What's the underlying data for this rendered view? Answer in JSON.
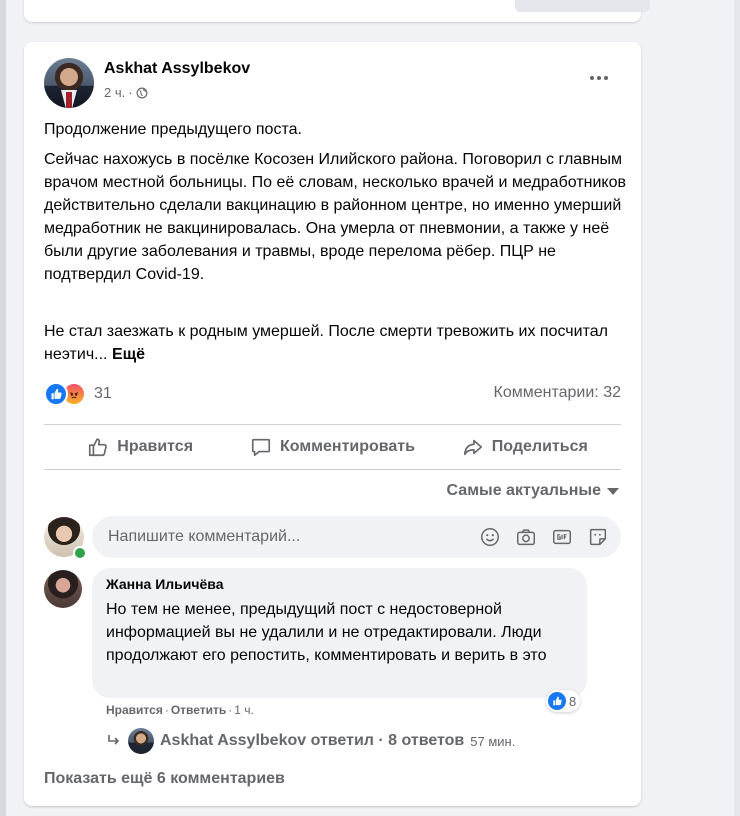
{
  "post": {
    "author": "Askhat Assylbekov",
    "time": "2 ч.",
    "separator": "·",
    "paragraph1": "Продолжение предыдущего поста.",
    "paragraph2": "Сейчас нахожусь в посёлке Косозен Илийского района. Поговорил с главным врачом местной больницы. По её словам, несколько врачей и медработников действительно сделали вакцинацию в районном центре, но именно умерший медработник не вакцинировалась. Она умерла от пневмонии, а также у неё были другие заболевания и травмы, вроде перелома рёбер. ПЦР не подтвердил Covid-19.",
    "paragraph3": "Не стал заезжать к родным умершей. После смерти тревожить их посчитал неэтич...",
    "see_more": "Ещё",
    "reaction_count": "31",
    "comments_count": "Комментарии: 32"
  },
  "actions": {
    "like": "Нравится",
    "comment": "Комментировать",
    "share": "Поделиться"
  },
  "sort": {
    "label": "Самые актуальные"
  },
  "comment_input": {
    "placeholder": "Напишите комментарий..."
  },
  "comments": [
    {
      "author": "Жанна Ильичёва",
      "text": "Но тем не менее, предыдущий пост с недостоверной информацией вы не удалили и не отредактировали. Люди продолжают его репостить, комментировать и верить в это",
      "like_count": "8",
      "like_label": "Нравится",
      "reply_label": "Ответить",
      "time": "1 ч.",
      "reply_summary": "Askhat Assylbekov ответил · 8 ответов",
      "reply_time": "57 мин."
    }
  ],
  "show_more": "Показать ещё 6 комментариев",
  "colors": {
    "accent": "#1877f2",
    "text": "#050505",
    "secondary_text": "#65676b",
    "background": "#f0f2f5",
    "online": "#31a24c"
  },
  "icons": {
    "post_privacy": "globe-icon",
    "more": "more-horizontal-icon",
    "like": "thumbs-up-icon",
    "comment": "comment-bubble-icon",
    "share": "share-arrow-icon",
    "emoji": "emoji-icon",
    "camera": "camera-icon",
    "gif": "gif-icon",
    "sticker": "sticker-icon",
    "reply": "reply-arrow-icon"
  }
}
